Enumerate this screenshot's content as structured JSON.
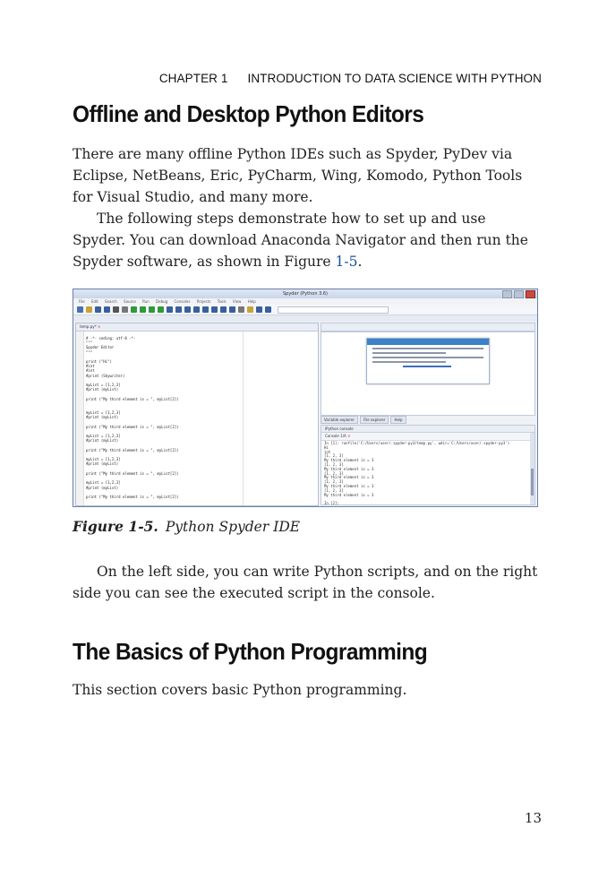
{
  "running_header": {
    "chapter": "CHAPTER 1",
    "title": "INTRODUCTION TO DATA SCIENCE WITH PYTHON"
  },
  "section1": {
    "heading": "Offline and Desktop Python Editors",
    "para1": "There are many offline Python IDEs such as Spyder, PyDev via Eclipse, NetBeans, Eric, PyCharm, Wing, Komodo, Python Tools for Visual Studio, and many more.",
    "para2_before": "The following steps demonstrate how to set up and use Spyder. You can download Anaconda Navigator and then run the Spyder software, as shown in Figure ",
    "para2_ref": "1-5",
    "para2_after": "."
  },
  "figure": {
    "window_title": "Spyder (Python 3.6)",
    "menu": [
      "File",
      "Edit",
      "Search",
      "Source",
      "Run",
      "Debug",
      "Consoles",
      "Projects",
      "Tools",
      "View",
      "Help"
    ],
    "editor_tab": "temp.py*",
    "code": "# -*- coding: utf-8 -*-\n\"\"\"\nSpyder Editor\n\"\"\"\n\nprint (\"Hi\")\n#int\n#int\n#print (Skywriter)\n\nmyList = [1,2,3]\n#print (myList)\n\nprint (\"My third element is = \", myList[2])\n\n\nmyList = [1,2,3]\n#print (myList)\n\nprint (\"My third element is = \", myList[2])\n\nmyList = [1,2,3]\n#print (myList)\n\nprint (\"My third element is = \", myList[2])\n\nmyList = [1,2,3]\n#print (myList)\n\nprint (\"My third element is = \", myList[2])\n\nmyList = [1,2,3]\n#print (myList)\n\nprint (\"My third element is = \", myList[2])",
    "help_tabs": [
      "Variable explorer",
      "File explorer",
      "Help"
    ],
    "console_title": "IPython console",
    "console_tab": "Console 1/A",
    "console_text": "In [1]: runfile('C:/Users/user/.spyder-py3/temp.py', wdir='C:/Users/user/.spyder-py3')\nHi\nint\n[1, 2, 3]\nMy third element is = 3\n[1, 2, 3]\nMy third element is = 3\n[1, 2, 3]\nMy third element is = 3\n[1, 2, 3]\nMy third element is = 3\n[1, 2, 3]\nMy third element is = 3\n\nIn [2]:",
    "caption_label": "Figure 1-5.",
    "caption_text": "Python Spyder IDE"
  },
  "para3": "On the left side, you can write Python scripts, and on the right side you can see the executed script in the console.",
  "section2": {
    "heading": "The Basics of Python Programming",
    "para": "This section covers basic Python programming."
  },
  "page_number": "13",
  "colors": {
    "link": "#1a4fa0",
    "console_accent": "#3b82c8",
    "window_close": "#c94a3e"
  }
}
